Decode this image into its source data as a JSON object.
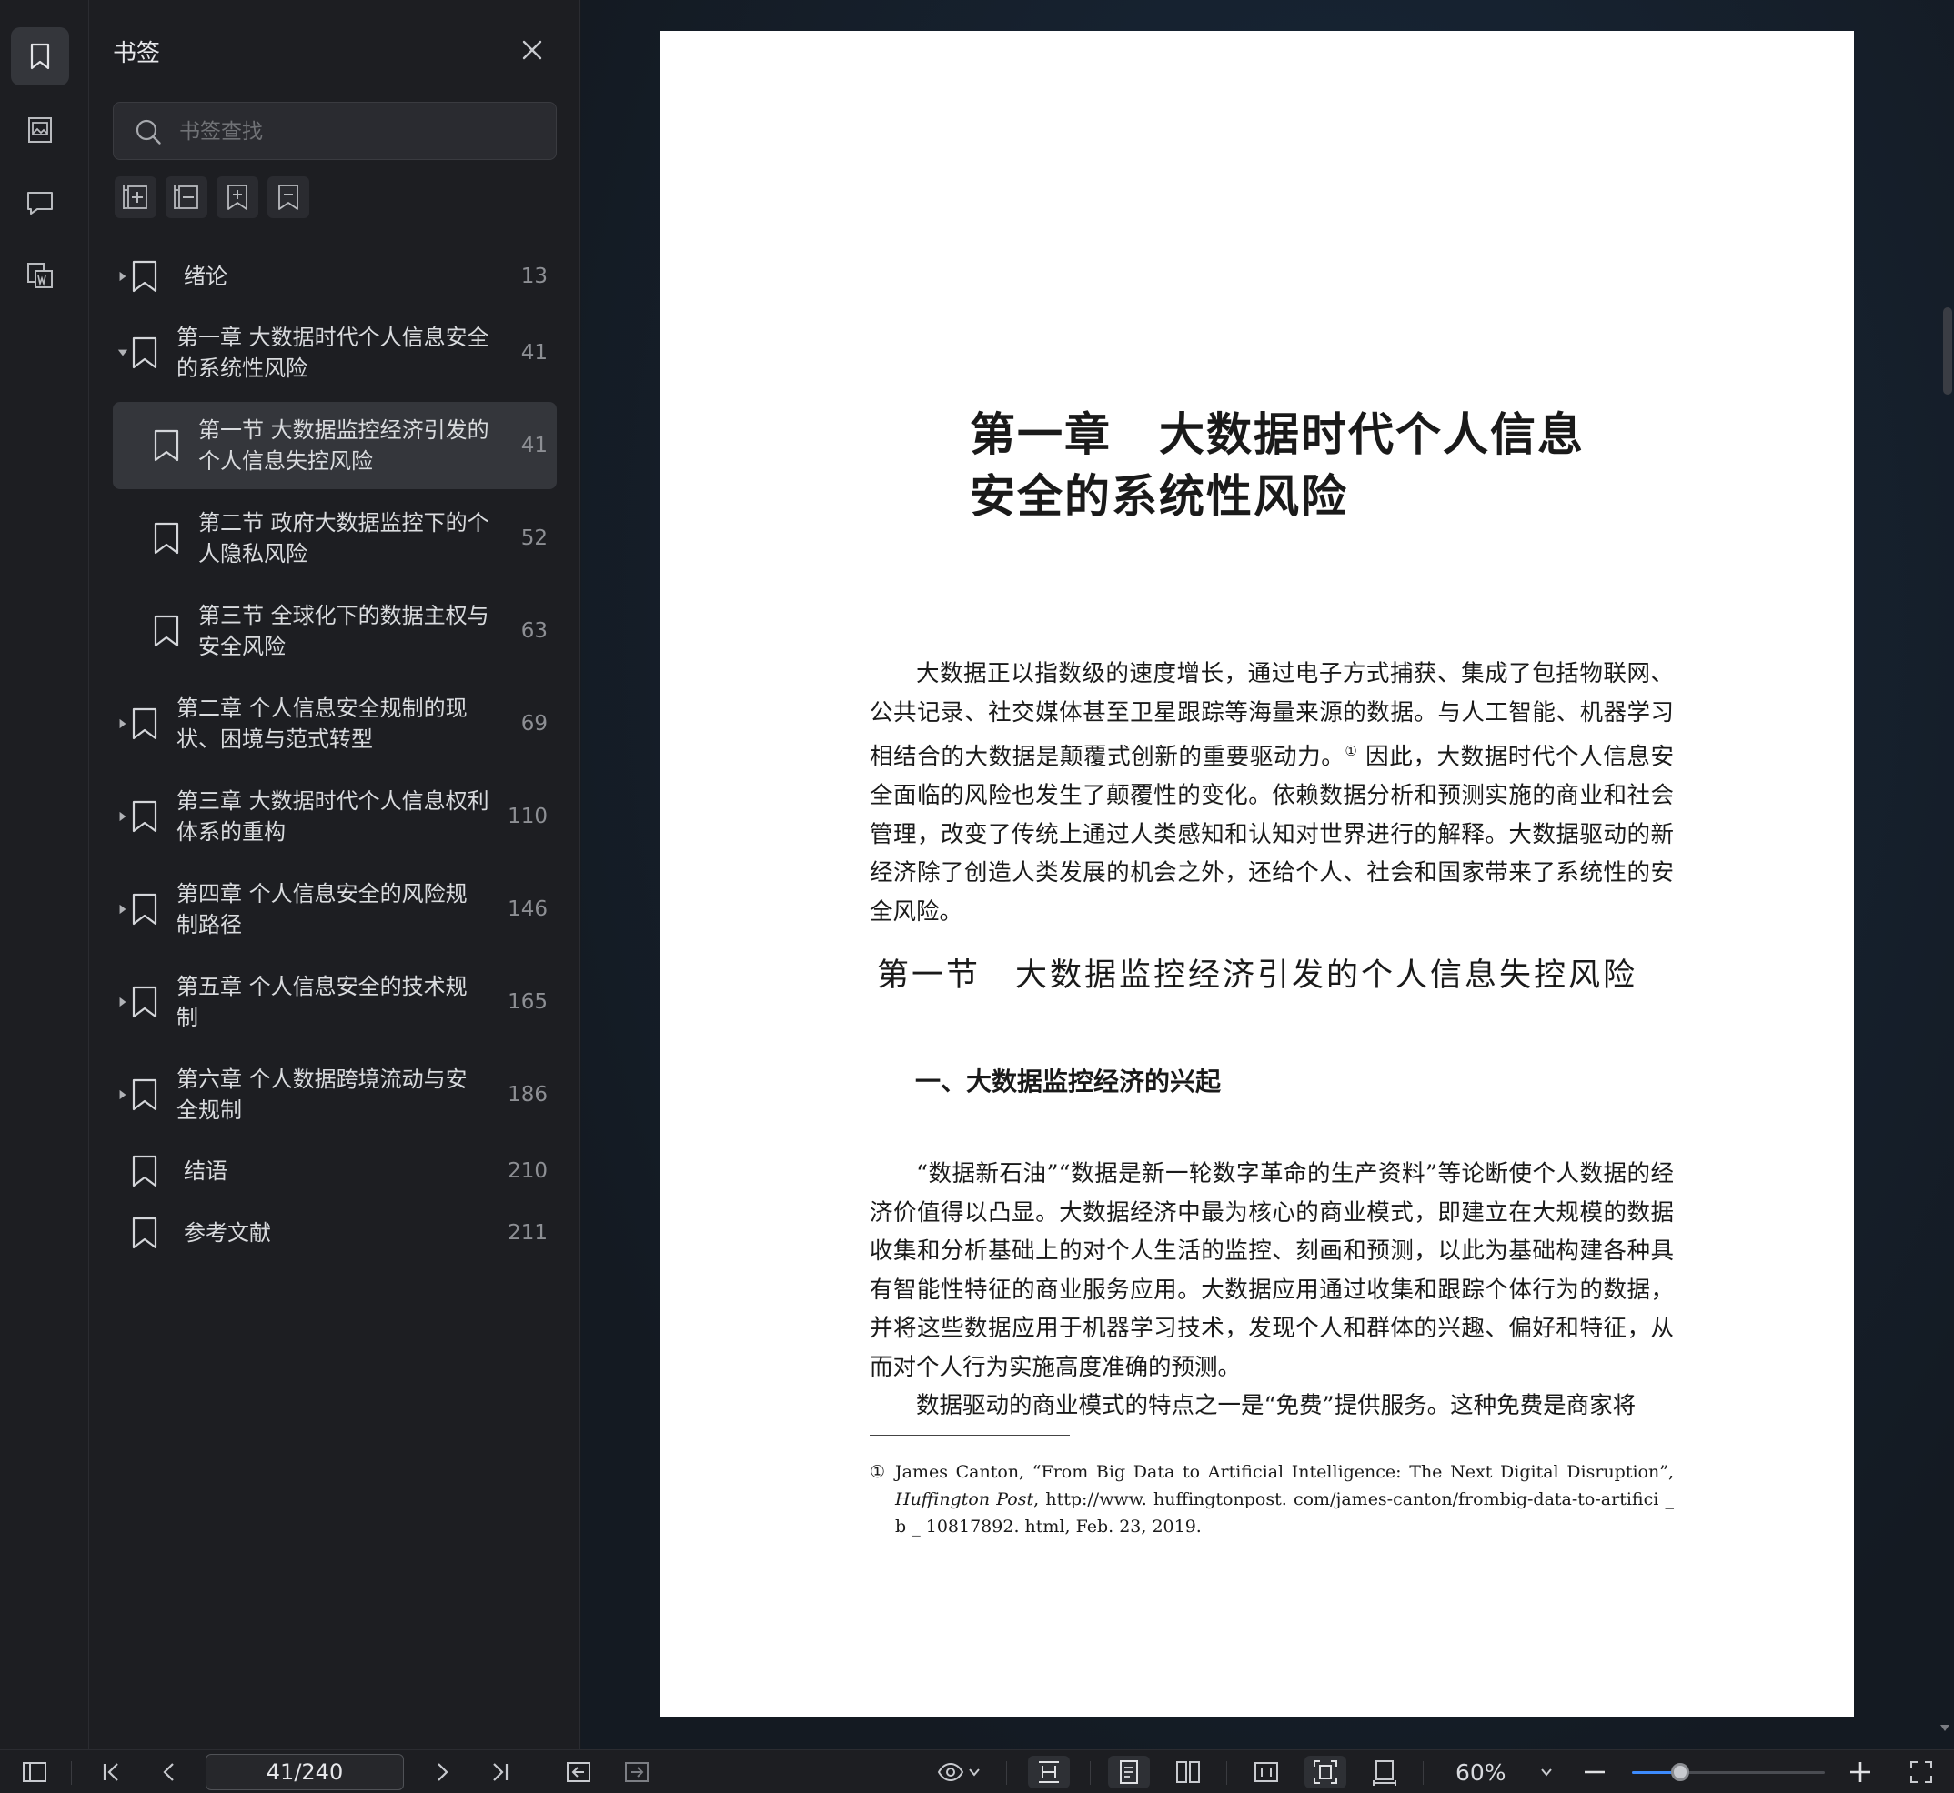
{
  "panel": {
    "title": "书签",
    "search_placeholder": "书签查找",
    "bookmarks": [
      {
        "label": "绪论",
        "page": "13"
      },
      {
        "label": "第一章 大数据时代个人信息安全的系统性风险",
        "page": "41"
      },
      {
        "label": "第一节 大数据监控经济引发的个人信息失控风险",
        "page": "41"
      },
      {
        "label": "第二节 政府大数据监控下的个人隐私风险",
        "page": "52"
      },
      {
        "label": "第三节 全球化下的数据主权与安全风险",
        "page": "63"
      },
      {
        "label": "第二章 个人信息安全规制的现状、困境与范式转型",
        "page": "69"
      },
      {
        "label": "第三章 大数据时代个人信息权利体系的重构",
        "page": "110"
      },
      {
        "label": "第四章 个人信息安全的风险规制路径",
        "page": "146"
      },
      {
        "label": "第五章 个人信息安全的技术规制",
        "page": "165"
      },
      {
        "label": "第六章 个人数据跨境流动与安全规制",
        "page": "186"
      },
      {
        "label": "结语",
        "page": "210"
      },
      {
        "label": "参考文献",
        "page": "211"
      }
    ]
  },
  "document": {
    "chapter_title": "第一章　大数据时代个人信息\n安全的系统性风险",
    "intro_paragraph_a": "大数据正以指数级的速度增长，通过电子方式捕获、集成了包括物联网、公共记录、社交媒体甚至卫星跟踪等海量来源的数据。与人工智能、机器学习相结合的大数据是颠覆式创新的重要驱动力。",
    "footnote_marker": "①",
    "intro_paragraph_b": " 因此，大数据时代个人信息安全面临的风险也发生了颠覆性的变化。依赖数据分析和预测实施的商业和社会管理，改变了传统上通过人类感知和认知对世界进行的解释。大数据驱动的新经济除了创造人类发展的机会之外，还给个人、社会和国家带来了系统性的安全风险。",
    "section_title": "第一节　大数据监控经济引发的个人信息失控风险",
    "subsection_title": "一、大数据监控经济的兴起",
    "paragraph_1": "“数据新石油”“数据是新一轮数字革命的生产资料”等论断使个人数据的经济价值得以凸显。大数据经济中最为核心的商业模式，即建立在大规模的数据收集和分析基础上的对个人生活的监控、刻画和预测，以此为基础构建各种具有智能性特征的商业服务应用。大数据应用通过收集和跟踪个体行为的数据，并将这些数据应用于机器学习技术，发现个人和群体的兴趣、偏好和特征，从而对个人行为实施高度准确的预测。",
    "paragraph_2": "数据驱动的商业模式的特点之一是“免费”提供服务。这种免费是商家将",
    "footnote_num": "①",
    "footnote_text_a": "James Canton, “From Big Data to Artificial Intelligence: The Next Digital Disruption”, ",
    "footnote_italic": "Huffington Post",
    "footnote_text_b": ", http://www. huffingtonpost. com/james-canton/frombig-data-to-artifici _ b _ 10817892. html, Feb. 23, 2019."
  },
  "toolbar": {
    "page_indicator": "41/240",
    "zoom_label": "60%",
    "zoom_fraction": 0.25
  },
  "colors": {
    "accent": "#3d8bfd",
    "panel_bg": "#1d1e22",
    "selected_bg": "#34363b"
  }
}
